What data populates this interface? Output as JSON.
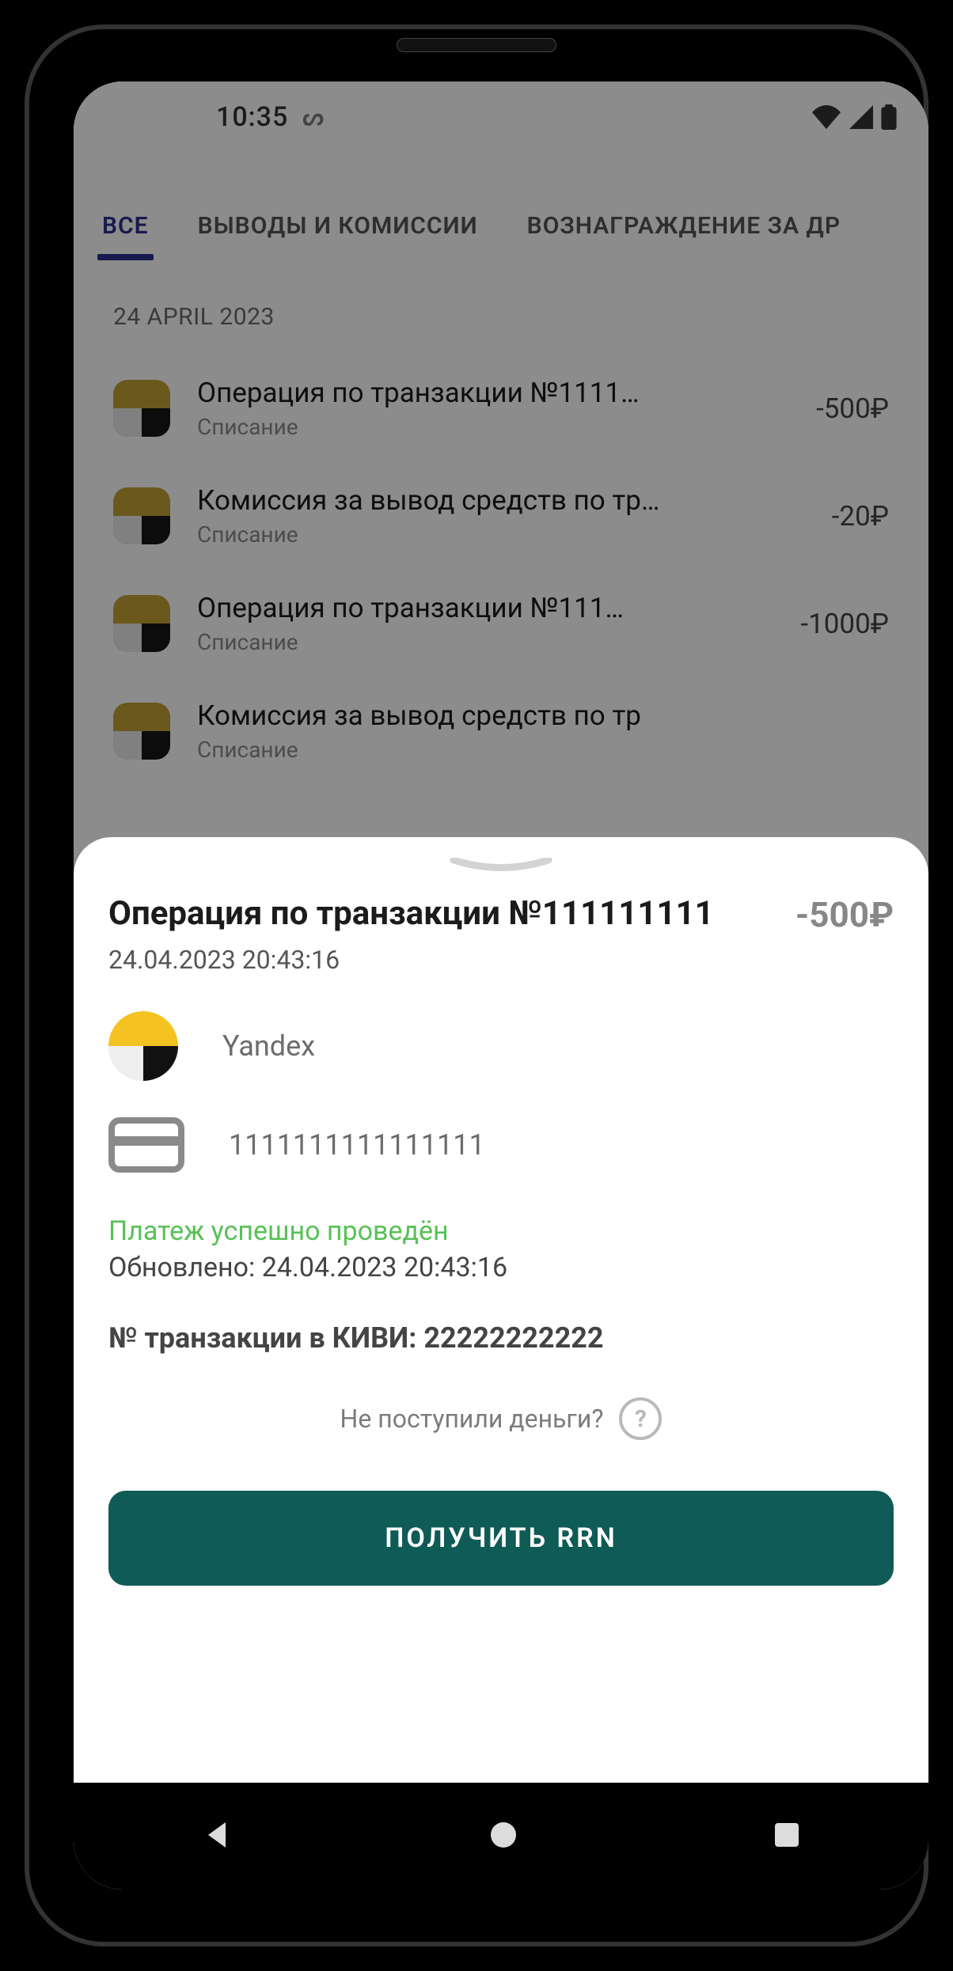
{
  "statusbar": {
    "time": "10:35"
  },
  "tabs": [
    {
      "label": "ВСЕ",
      "active": true
    },
    {
      "label": "ВЫВОДЫ И КОМИССИИ",
      "active": false
    },
    {
      "label": "ВОЗНАГРАЖДЕНИЕ ЗА ДР",
      "active": false
    }
  ],
  "section_date": "24 APRIL 2023",
  "transactions": [
    {
      "title": "Операция по транзакции №1111…",
      "subtitle": "Списание",
      "amount": "-500₽"
    },
    {
      "title": "Комиссия за вывод средств по тр…",
      "subtitle": "Списание",
      "amount": "-20₽"
    },
    {
      "title": "Операция по транзакции №111…",
      "subtitle": "Списание",
      "amount": "-1000₽"
    },
    {
      "title": "Комиссия за вывод средств по тр",
      "subtitle": "Списание",
      "amount": ""
    }
  ],
  "sheet": {
    "title": "Операция по транзакции №111111111",
    "amount": "-500₽",
    "datetime": "24.04.2023 20:43:16",
    "merchant": "Yandex",
    "card_number": "1111111111111111",
    "status_ok": "Платеж успешно проведён",
    "updated": "Обновлено: 24.04.2023 20:43:16",
    "kiwi": "№ транзакции в КИВИ: 22222222222",
    "help_text": "Не поступили деньги?",
    "primary_button": "ПОЛУЧИТЬ RRN"
  }
}
